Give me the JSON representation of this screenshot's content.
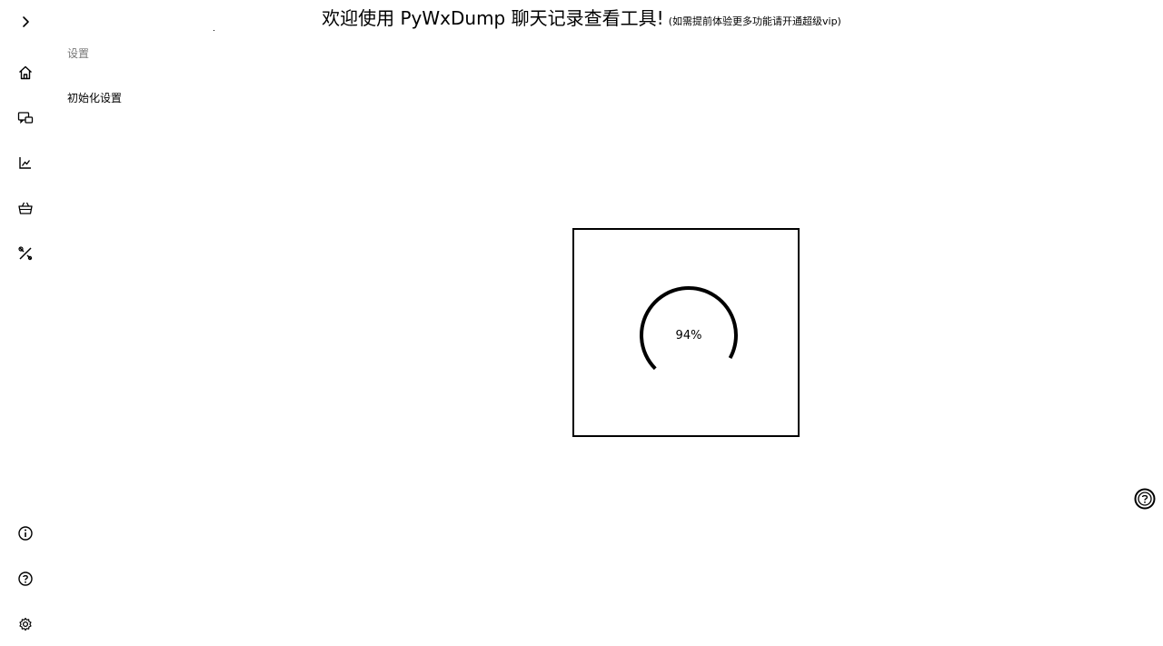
{
  "header": {
    "title": "欢迎使用 PyWxDump 聊天记录查看工具!",
    "subtitle": "(如需提前体验更多功能请开通超级vip)"
  },
  "sidebar": {
    "top_items": [
      {
        "icon": "chevron-right-icon"
      },
      {
        "icon": "home-icon"
      },
      {
        "icon": "chat-icon"
      },
      {
        "icon": "chart-icon"
      },
      {
        "icon": "basket-icon"
      },
      {
        "icon": "tools-icon"
      }
    ],
    "bottom_items": [
      {
        "icon": "info-icon"
      },
      {
        "icon": "help-icon"
      },
      {
        "icon": "settings-icon"
      }
    ]
  },
  "subnav": {
    "header": "设置",
    "items": [
      {
        "label": "初始化设置"
      }
    ]
  },
  "loading": {
    "progress": 94,
    "progress_label": "94%"
  },
  "floating": {
    "icon": "assistant-icon"
  }
}
